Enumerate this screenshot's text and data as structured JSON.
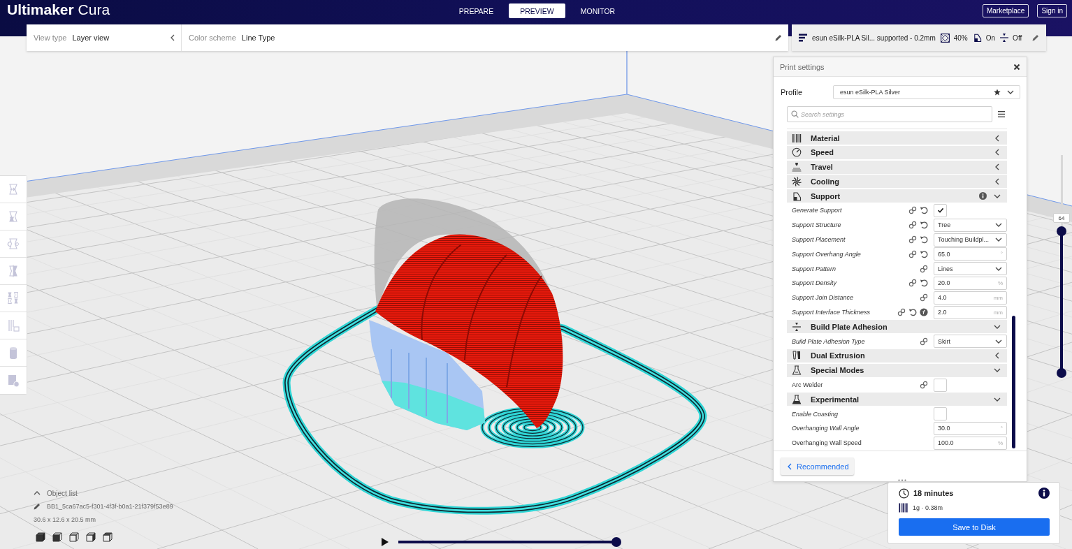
{
  "app_title": "**Ultimaker** Cura",
  "stages": [
    {
      "label": "PREPARE",
      "selected": false
    },
    {
      "label": "PREVIEW",
      "selected": true
    },
    {
      "label": "MONITOR",
      "selected": false
    }
  ],
  "account_buttons": [
    {
      "label": "Marketplace"
    },
    {
      "label": "Sign in"
    }
  ],
  "view_bar": {
    "view_type": {
      "label": "View type",
      "value": "Layer view"
    },
    "color_scheme": {
      "label": "Color scheme",
      "value": "Line Type"
    }
  },
  "print_setup_bar": {
    "profile": "esun eSilk-PLA Sil... supported - 0.2mm",
    "infill": "40%",
    "support": "On",
    "adhesion": "Off"
  },
  "print_settings": {
    "title": "Print settings",
    "profile": {
      "label": "Profile",
      "value": "esun eSilk-PLA Silver"
    },
    "search": {
      "placeholder": "Search settings"
    },
    "categories": [
      {
        "name": "Material",
        "expanded": false,
        "notice": false
      },
      {
        "name": "Speed",
        "expanded": false,
        "notice": false
      },
      {
        "name": "Travel",
        "expanded": false,
        "notice": false
      },
      {
        "name": "Cooling",
        "expanded": false,
        "notice": false
      },
      {
        "name": "Support",
        "expanded": true,
        "notice": true,
        "settings": [
          {
            "label": "Generate Support",
            "modified": true,
            "linked": true,
            "revertible": true,
            "overridden": false,
            "kind": "checkbox",
            "checked": true
          },
          {
            "label": "Support Structure",
            "modified": true,
            "linked": true,
            "revertible": true,
            "overridden": false,
            "kind": "dropdown",
            "value": "Tree"
          },
          {
            "label": "Support Placement",
            "modified": true,
            "linked": true,
            "revertible": true,
            "overridden": false,
            "kind": "dropdown",
            "value": "Touching Buildpl..."
          },
          {
            "label": "Support Overhang Angle",
            "modified": true,
            "linked": true,
            "revertible": true,
            "overridden": false,
            "kind": "number",
            "value": "65.0",
            "unit": "°"
          },
          {
            "label": "Support Pattern",
            "modified": true,
            "linked": true,
            "revertible": false,
            "overridden": false,
            "kind": "dropdown",
            "value": "Lines"
          },
          {
            "label": "Support Density",
            "modified": true,
            "linked": true,
            "revertible": true,
            "overridden": false,
            "kind": "number",
            "value": "20.0",
            "unit": "%"
          },
          {
            "label": "Support Join Distance",
            "modified": true,
            "linked": true,
            "revertible": false,
            "overridden": false,
            "kind": "number",
            "value": "4.0",
            "unit": "mm"
          },
          {
            "label": "Support Interface Thickness",
            "modified": true,
            "linked": true,
            "revertible": true,
            "overridden": true,
            "kind": "number",
            "value": "2.0",
            "unit": "mm"
          }
        ]
      },
      {
        "name": "Build Plate Adhesion",
        "expanded": true,
        "notice": false,
        "settings": [
          {
            "label": "Build Plate Adhesion Type",
            "modified": true,
            "linked": true,
            "revertible": false,
            "overridden": false,
            "kind": "dropdown",
            "value": "Skirt"
          }
        ]
      },
      {
        "name": "Dual Extrusion",
        "expanded": false,
        "notice": false
      },
      {
        "name": "Special Modes",
        "expanded": true,
        "notice": false,
        "settings": [
          {
            "label": "Arc Welder",
            "modified": false,
            "linked": true,
            "revertible": false,
            "overridden": false,
            "kind": "checkbox",
            "checked": false
          }
        ]
      },
      {
        "name": "Experimental",
        "expanded": true,
        "notice": false,
        "settings": [
          {
            "label": "Enable Coasting",
            "modified": true,
            "linked": false,
            "revertible": false,
            "overridden": false,
            "kind": "checkbox",
            "checked": false
          },
          {
            "label": "Overhanging Wall Angle",
            "modified": true,
            "linked": false,
            "revertible": false,
            "overridden": false,
            "kind": "number",
            "value": "30.0",
            "unit": "°"
          },
          {
            "label": "Overhanging Wall Speed",
            "modified": false,
            "linked": false,
            "revertible": false,
            "overridden": false,
            "kind": "number",
            "value": "100.0",
            "unit": "%"
          }
        ]
      }
    ],
    "mode_button": "Recommended"
  },
  "object_info": {
    "heading": "Object list",
    "expanded": false,
    "name": "BB1_5ca67ac5-f301-4f3f-b0a1-21f379f53e89",
    "dimensions": "30.6 x 12.6 x 20.5 mm"
  },
  "layer_slider": {
    "label": "64",
    "handles": [
      {
        "level": 0.65
      },
      {
        "level": 0
      }
    ]
  },
  "simulation": {
    "level": 1
  },
  "output": {
    "time": "18 minutes",
    "material": "1g · 0.38m",
    "action": "Save to Disk"
  }
}
